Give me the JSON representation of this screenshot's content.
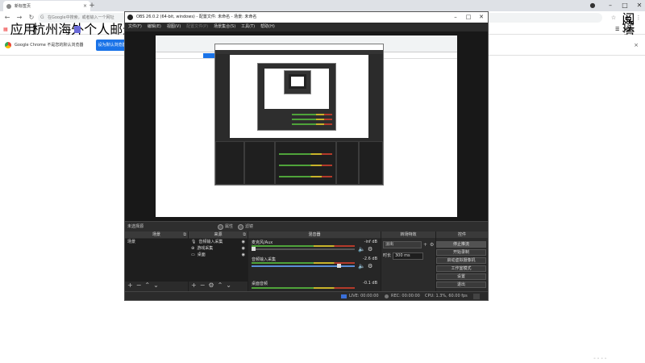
{
  "browser": {
    "tab_title": "新标签页",
    "tab_close": "×",
    "new_tab": "+",
    "omnibox_placeholder": "在Google中搜索，或者输入一个网址",
    "bookmarks": [
      {
        "label": "应用"
      },
      {
        "label": "杭州海外个人邮递..."
      }
    ],
    "reading_list": "阅读清单",
    "infobar_text": "Google Chrome 不是您的默认浏览器",
    "infobar_button": "设为默认浏览器",
    "infobar_close": "×"
  },
  "obs": {
    "window_title": "OBS 26.0.2 (64-bit, windows) - 配置文件: 未命名 - 场景: 未命名",
    "menu": [
      "文件(F)",
      "编辑(E)",
      "视图(V)",
      "配置文件(P)",
      "场景集合(S)",
      "工具(T)",
      "帮助(H)"
    ],
    "no_source_label": "未选择源",
    "radio_properties": "属性",
    "radio_filters": "滤镜",
    "docks": {
      "scenes_title": "场景",
      "sources_title": "来源",
      "mixer_title": "混音器",
      "transitions_title": "转场特效",
      "controls_title": "控件"
    },
    "scenes": [
      "场景"
    ],
    "sources": [
      {
        "icon": "mic",
        "label": "音频输入采集"
      },
      {
        "icon": "gamepad",
        "label": "游戏采集"
      },
      {
        "icon": "monitor",
        "label": "桌面"
      }
    ],
    "mixer": [
      {
        "name": "麦克风/Aux",
        "db": "-inf dB",
        "level": 0.0
      },
      {
        "name": "音频输入采集",
        "db": "-2.6 dB",
        "level": 0.9
      },
      {
        "name": "桌面音频",
        "db": "-0.1 dB",
        "level": 1.0
      }
    ],
    "transition_select": "淡出",
    "duration_label": "时长",
    "duration_value": "300 ms",
    "controls": [
      "停止推流",
      "开始录制",
      "启动虚拟摄像机",
      "工作室模式",
      "设置",
      "退出"
    ],
    "status": {
      "live_label": "LIVE: 00:00:00",
      "rec_label": "REC: 00:00:00",
      "cpu_label": "CPU: 1.3%, 60.00 fps"
    }
  },
  "colors": {
    "obs_bg": "#2b2b2b",
    "chrome_accent": "#1a73e8",
    "meter_green": "#4fa33a",
    "meter_yellow": "#c9b32a",
    "meter_red": "#b33a2a"
  }
}
